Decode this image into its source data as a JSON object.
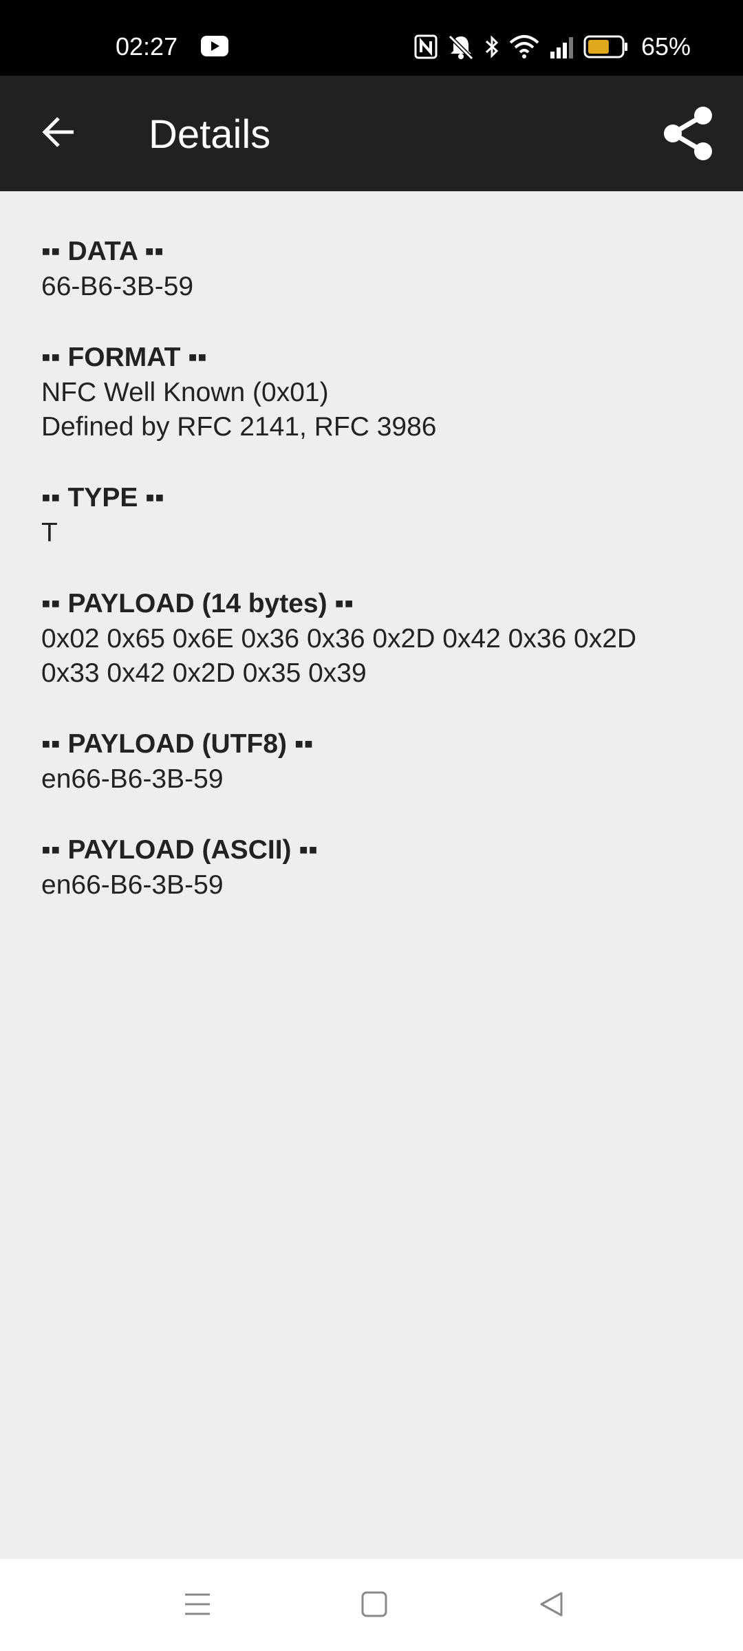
{
  "status_bar": {
    "time": "02:27",
    "icons": [
      "youtube-icon",
      "nfc-icon",
      "muted-bell-icon",
      "bluetooth-icon",
      "wifi-icon",
      "signal-icon",
      "battery-icon"
    ],
    "battery_percent": "65%",
    "battery_color": "#e0a81c"
  },
  "app_bar": {
    "title": "Details",
    "back_icon": "arrow-left-icon",
    "share_icon": "share-icon",
    "background": "#212121"
  },
  "sections": [
    {
      "header": "▪▪ DATA ▪▪",
      "lines": [
        "66-B6-3B-59"
      ]
    },
    {
      "header": "▪▪ FORMAT ▪▪",
      "lines": [
        "NFC Well Known (0x01)",
        "Defined by RFC 2141, RFC 3986"
      ]
    },
    {
      "header": "▪▪ TYPE ▪▪",
      "lines": [
        "T"
      ]
    },
    {
      "header": "▪▪ PAYLOAD (14 bytes) ▪▪",
      "lines": [
        "0x02 0x65 0x6E 0x36 0x36 0x2D 0x42 0x36 0x2D",
        "0x33 0x42 0x2D 0x35 0x39"
      ]
    },
    {
      "header": "▪▪ PAYLOAD (UTF8) ▪▪",
      "lines": [
        "en66-B6-3B-59"
      ]
    },
    {
      "header": "▪▪ PAYLOAD (ASCII) ▪▪",
      "lines": [
        "en66-B6-3B-59"
      ]
    }
  ],
  "nav_bar": {
    "icons": [
      "menu-icon",
      "home-square-icon",
      "back-triangle-icon"
    ]
  }
}
